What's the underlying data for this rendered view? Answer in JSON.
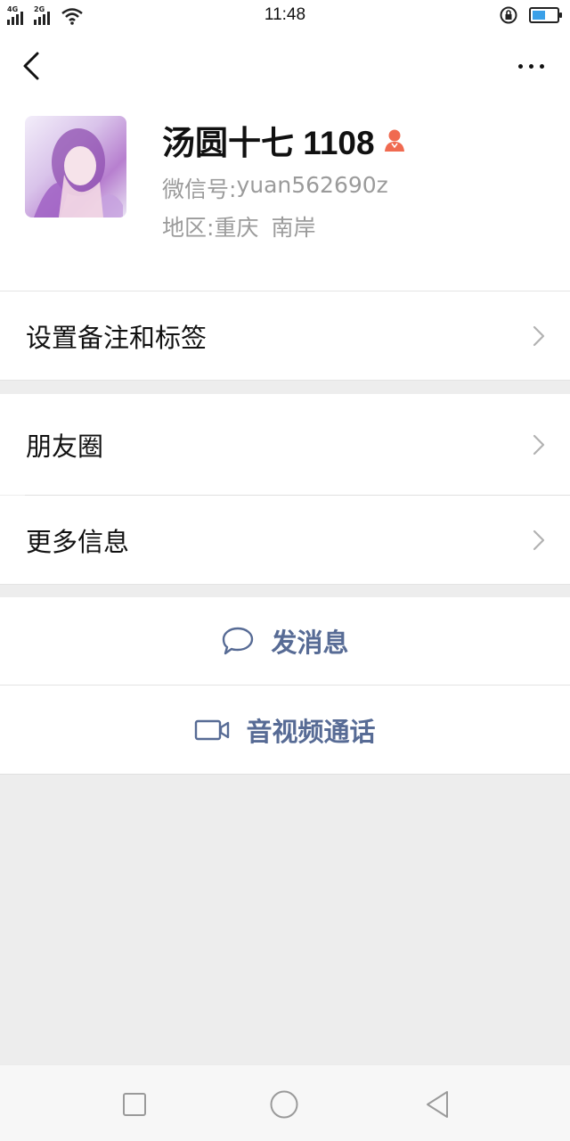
{
  "status_bar": {
    "time": "11:48",
    "sim1": "4G",
    "sim2": "2G",
    "battery_level": 0.55,
    "icons": [
      "signal-icon",
      "wifi-icon",
      "rotation-lock-icon",
      "battery-icon"
    ]
  },
  "header": {
    "back_icon": "chevron-left-icon",
    "more_icon": "more-dots-icon"
  },
  "profile": {
    "nickname": "汤圆十七 1108",
    "gender_icon": "female-icon",
    "gender_color": "#f06a50",
    "wxid_label": "微信号:",
    "wxid": "yuan562690z",
    "region_label": "地区:",
    "region_city": "重庆",
    "region_district": "南岸"
  },
  "cells": {
    "remark": "设置备注和标签",
    "moments": "朋友圈",
    "more_info": "更多信息"
  },
  "actions": {
    "message": "发消息",
    "call": "音视频通话",
    "accent": "#576b95"
  },
  "nav_bar": {
    "icons": [
      "recent-apps-icon",
      "home-icon",
      "back-triangle-icon"
    ]
  }
}
